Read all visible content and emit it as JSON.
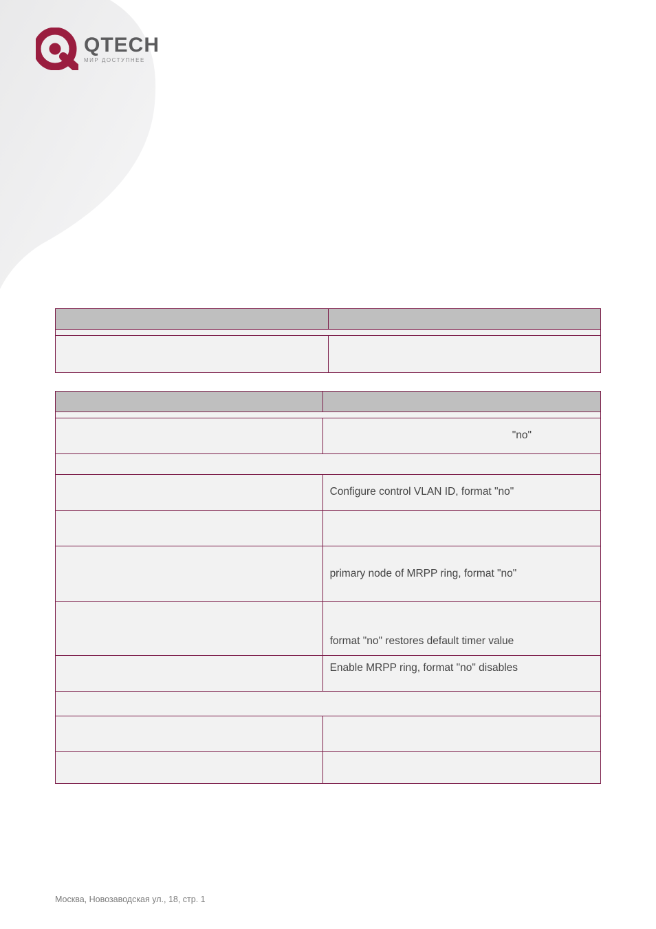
{
  "logo": {
    "brand": "QTECH",
    "tagline": "МИР ДОСТУПНЕЕ"
  },
  "table1": {
    "header": {
      "c1": "",
      "c2": ""
    },
    "span_row": "",
    "row": {
      "cmd": "",
      "desc": ""
    }
  },
  "table2": {
    "header": {
      "c1": "",
      "c2": ""
    },
    "span_a": "",
    "row_a": {
      "cmd": "",
      "desc_visible": "\"no\""
    },
    "span_b": "",
    "rows_b": [
      {
        "cmd": "",
        "desc_visible": "Configure control VLAN ID, format \"no\""
      },
      {
        "cmd": "",
        "desc_visible": ""
      },
      {
        "cmd": "",
        "desc_visible": "primary node of MRPP ring, format \"no\""
      },
      {
        "cmd": "",
        "desc_visible": "format \"no\" restores default timer value"
      },
      {
        "cmd": "",
        "desc_visible": "Enable MRPP ring, format \"no\" disables"
      }
    ],
    "span_c": "",
    "rows_c": [
      {
        "cmd": "",
        "desc": ""
      },
      {
        "cmd": "",
        "desc": ""
      }
    ]
  },
  "footer": "Москва, Новозаводская ул., 18, стр. 1"
}
